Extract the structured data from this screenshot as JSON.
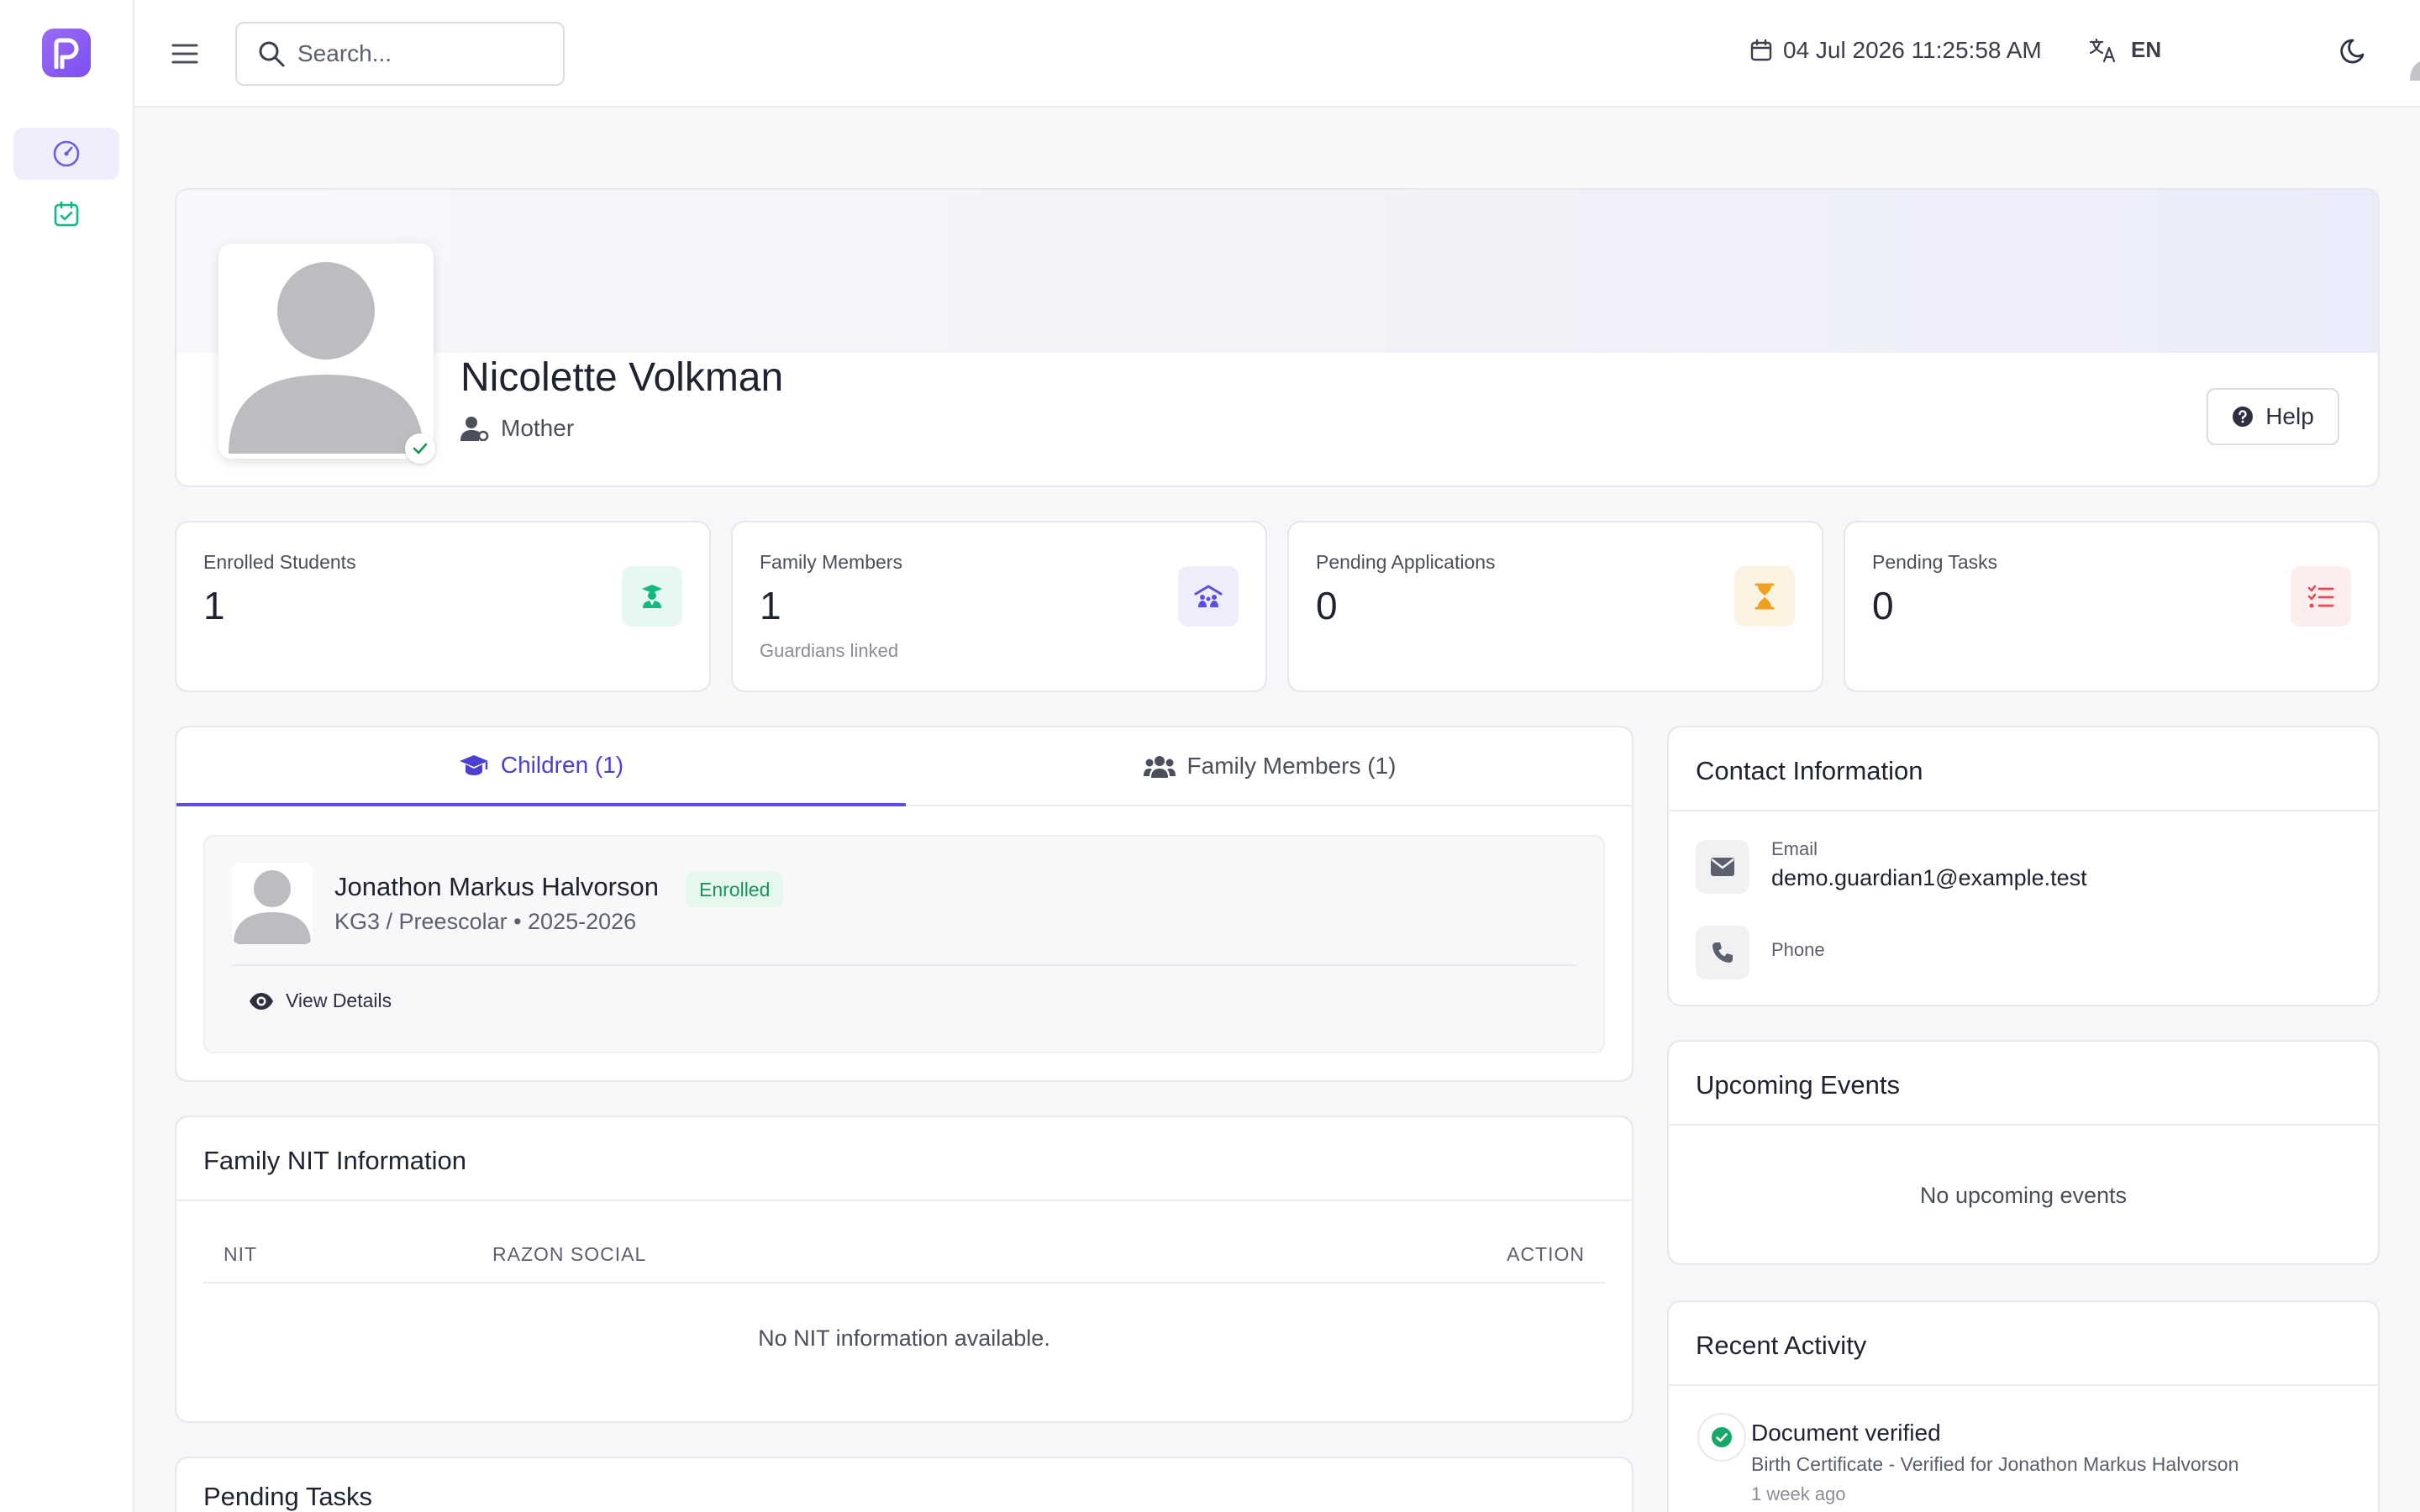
{
  "topbar": {
    "search_placeholder": "Search...",
    "datetime": "04 Jul 2026 11:25:58 AM",
    "language": "EN"
  },
  "profile": {
    "name": "Nicolette Volkman",
    "role": "Mother",
    "help_label": "Help"
  },
  "stats": [
    {
      "label": "Enrolled Students",
      "value": "1",
      "sub": "",
      "icon": "graduate-icon",
      "color": "#10b981",
      "bg": "#e7f8f1"
    },
    {
      "label": "Family Members",
      "value": "1",
      "sub": "Guardians linked",
      "icon": "family-icon",
      "color": "#5b4fe0",
      "bg": "#eeedfb"
    },
    {
      "label": "Pending Applications",
      "value": "0",
      "sub": "",
      "icon": "hourglass-icon",
      "color": "#f0a020",
      "bg": "#fdf3e3"
    },
    {
      "label": "Pending Tasks",
      "value": "0",
      "sub": "",
      "icon": "task-list-icon",
      "color": "#e5484d",
      "bg": "#fdeeee"
    }
  ],
  "tabs": {
    "children": "Children (1)",
    "family_members": "Family Members (1)"
  },
  "child": {
    "name": "Jonathon Markus Halvorson",
    "status": "Enrolled",
    "class": "KG3 / Preescolar • 2025-2026",
    "view_details": "View Details"
  },
  "nit": {
    "title": "Family NIT Information",
    "columns": [
      "NIT",
      "RAZON SOCIAL",
      "ACTION"
    ],
    "empty": "No NIT information available."
  },
  "pending_tasks": {
    "title": "Pending Tasks"
  },
  "contact": {
    "title": "Contact Information",
    "email_label": "Email",
    "email_value": "demo.guardian1@example.test",
    "phone_label": "Phone"
  },
  "events": {
    "title": "Upcoming Events",
    "empty": "No upcoming events"
  },
  "activity": {
    "title": "Recent Activity",
    "items": [
      {
        "title": "Document verified",
        "description": "Birth Certificate - Verified for Jonathon Markus Halvorson",
        "time": "1 week ago"
      }
    ]
  }
}
